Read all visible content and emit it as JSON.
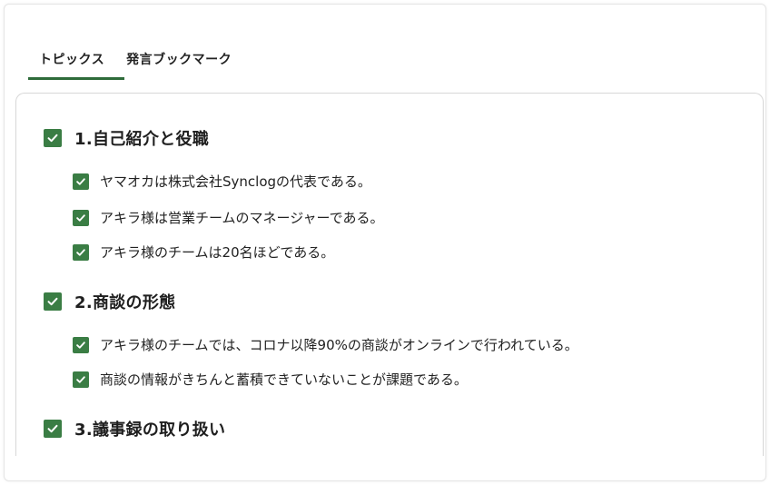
{
  "tabs": [
    {
      "label": "トピックス",
      "active": true
    },
    {
      "label": "発言ブックマーク",
      "active": false
    }
  ],
  "colors": {
    "accent": "#3a7d44",
    "tab_underline": "#2e6b3a"
  },
  "topics": [
    {
      "title": "1.自己紹介と役職",
      "checked": true,
      "items": [
        {
          "text": "ヤマオカは株式会社Synclogの代表である。",
          "checked": true
        },
        {
          "text": "アキラ様は営業チームのマネージャーである。",
          "checked": true
        },
        {
          "text": "アキラ様のチームは20名ほどである。",
          "checked": true
        }
      ]
    },
    {
      "title": "2.商談の形態",
      "checked": true,
      "items": [
        {
          "text": "アキラ様のチームでは、コロナ以降90%の商談がオンラインで行われている。",
          "checked": true
        },
        {
          "text": "商談の情報がきちんと蓄積できていないことが課題である。",
          "checked": true
        }
      ]
    },
    {
      "title": "3.議事録の取り扱い",
      "checked": true,
      "items": []
    }
  ]
}
